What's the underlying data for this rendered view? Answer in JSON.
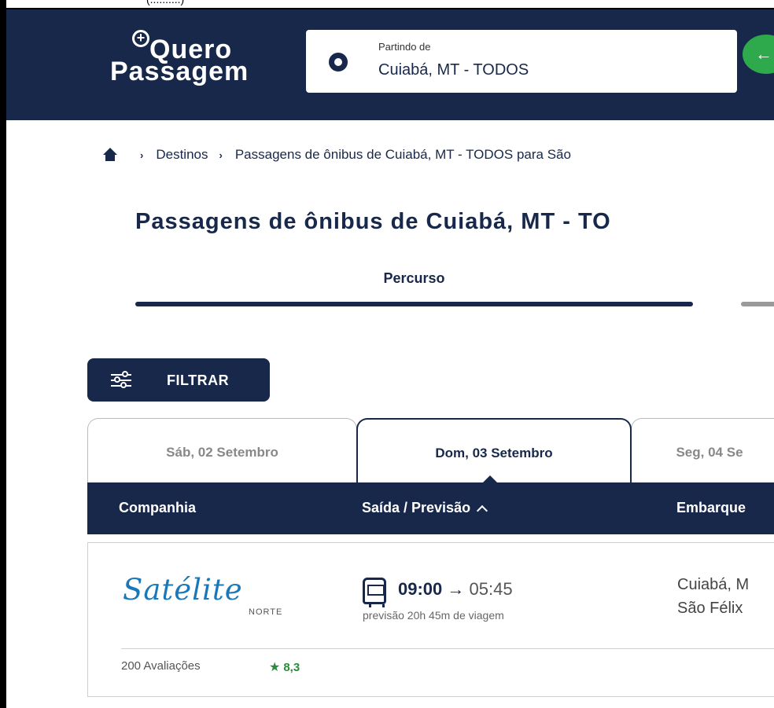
{
  "top_strip": {
    "cut_text": "(..........)"
  },
  "header": {
    "logo_line1": "Quero",
    "logo_line2": "Passagem",
    "origin": {
      "label": "Partindo de",
      "value": "Cuiabá, MT - TODOS"
    },
    "swap_glyph": "←",
    "colors": {
      "navy": "#17284a",
      "green": "#2ea94b"
    }
  },
  "breadcrumb": {
    "items": [
      "Destinos",
      "Passagens de ônibus de Cuiabá, MT - TODOS para São"
    ]
  },
  "page": {
    "title": "Passagens de ônibus de Cuiabá, MT - TO",
    "tabs": [
      {
        "label": "Percurso",
        "active": true
      }
    ]
  },
  "filter": {
    "label": "FILTRAR"
  },
  "date_tabs": [
    {
      "label": "Sáb, 02 Setembro",
      "active": false
    },
    {
      "label": "Dom, 03 Setembro",
      "active": true
    },
    {
      "label": "Seg, 04 Se",
      "active": false
    }
  ],
  "columns": [
    "Companhia",
    "Saída / Previsão",
    "Embarque"
  ],
  "results": [
    {
      "company": "Satélite",
      "company_sub": "NORTE",
      "departure": "09:00",
      "arrow": "→",
      "arrival": "05:45",
      "duration": "previsão 20h 45m de viagem",
      "embarque_line1": "Cuiabá, M",
      "embarque_line2": "São Félix",
      "reviews": "200 Avaliações",
      "rating": "8,3"
    }
  ]
}
